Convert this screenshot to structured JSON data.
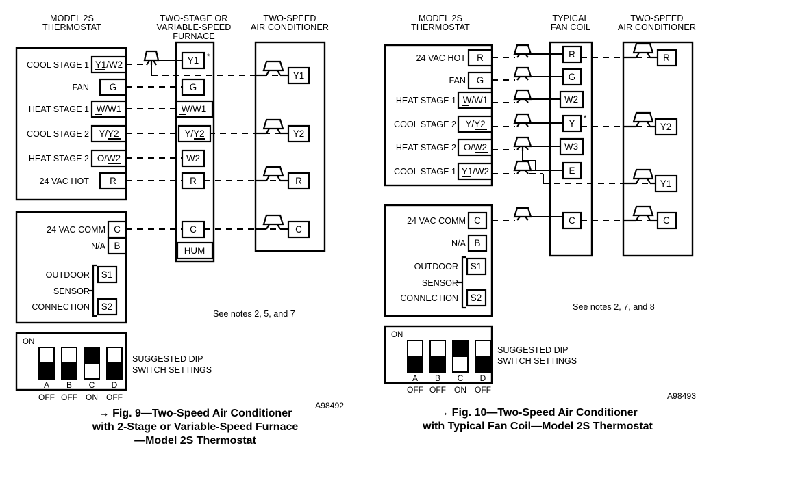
{
  "page": {
    "background": "#ffffff",
    "line_color": "#000000"
  },
  "figures": [
    {
      "id": "fig9",
      "code": "A98492",
      "notes": "See notes 2, 5, and 7",
      "caption_lines": [
        "→ Fig. 9—Two-Speed Air Conditioner",
        "with 2-Stage or Variable-Speed Furnace",
        "—Model 2S Thermostat"
      ],
      "column_headers": [
        {
          "name": "thermostat",
          "lines": [
            "MODEL 2S",
            "THERMOSTAT"
          ]
        },
        {
          "name": "furnace",
          "lines": [
            "TWO-STAGE OR",
            "VARIABLE-SPEED",
            "FURNACE"
          ]
        },
        {
          "name": "air-conditioner",
          "lines": [
            "TWO-SPEED",
            "AIR CONDITIONER"
          ]
        }
      ],
      "thermostat_upper": [
        {
          "label": "COOL STAGE 1",
          "terminal": "Y1/W2",
          "underline": "Y1"
        },
        {
          "label": "FAN",
          "terminal": "G",
          "underline": ""
        },
        {
          "label": "HEAT STAGE 1",
          "terminal": "W/W1",
          "underline": "W"
        },
        {
          "label": "COOL STAGE 2",
          "terminal": "Y/Y2",
          "underline": "Y2"
        },
        {
          "label": "HEAT STAGE 2",
          "terminal": "O/W2",
          "underline": "W2"
        },
        {
          "label": "24 VAC HOT",
          "terminal": "R",
          "underline": ""
        }
      ],
      "thermostat_lower": [
        {
          "label": "24 VAC COMM",
          "terminal": "C"
        },
        {
          "label": "N/A",
          "terminal": "B"
        },
        {
          "label": "OUTDOOR",
          "terminal": "S1"
        },
        {
          "label": "SENSOR",
          "terminal": ""
        },
        {
          "label": "CONNECTION",
          "terminal": "S2"
        }
      ],
      "middle_unit": [
        {
          "terminal": "Y1",
          "underline": "",
          "star": true
        },
        {
          "terminal": "G",
          "underline": ""
        },
        {
          "terminal": "W/W1",
          "underline": "W"
        },
        {
          "terminal": "Y/Y2",
          "underline": "Y2"
        },
        {
          "terminal": "W2",
          "underline": ""
        },
        {
          "terminal": "R",
          "underline": ""
        },
        {
          "terminal": "C",
          "underline": ""
        },
        {
          "terminal": "HUM",
          "underline": ""
        }
      ],
      "right_unit": [
        {
          "terminal": "Y1"
        },
        {
          "terminal": "Y2"
        },
        {
          "terminal": "R"
        },
        {
          "terminal": "C"
        }
      ],
      "dip": {
        "on_label": "ON",
        "title_lines": [
          "SUGGESTED DIP",
          "SWITCH SETTINGS"
        ],
        "switches": [
          {
            "name": "A",
            "state": "OFF"
          },
          {
            "name": "B",
            "state": "OFF"
          },
          {
            "name": "C",
            "state": "ON"
          },
          {
            "name": "D",
            "state": "OFF"
          }
        ]
      }
    },
    {
      "id": "fig10",
      "code": "A98493",
      "notes": "See notes 2, 7, and 8",
      "caption_lines": [
        "→ Fig. 10—Two-Speed Air Conditioner",
        "with Typical Fan Coil—Model 2S Thermostat"
      ],
      "column_headers": [
        {
          "name": "thermostat",
          "lines": [
            "MODEL 2S",
            "THERMOSTAT"
          ]
        },
        {
          "name": "fan-coil",
          "lines": [
            "TYPICAL",
            "FAN COIL"
          ]
        },
        {
          "name": "air-conditioner",
          "lines": [
            "TWO-SPEED",
            "AIR CONDITIONER"
          ]
        }
      ],
      "thermostat_upper": [
        {
          "label": "24 VAC HOT",
          "terminal": "R",
          "underline": ""
        },
        {
          "label": "FAN",
          "terminal": "G",
          "underline": ""
        },
        {
          "label": "HEAT STAGE 1",
          "terminal": "W/W1",
          "underline": "W"
        },
        {
          "label": "COOL STAGE 2",
          "terminal": "Y/Y2",
          "underline": "Y2"
        },
        {
          "label": "HEAT STAGE 2",
          "terminal": "O/W2",
          "underline": "W2"
        },
        {
          "label": "COOL STAGE 1",
          "terminal": "Y1/W2",
          "underline": "Y1"
        }
      ],
      "thermostat_lower": [
        {
          "label": "24 VAC COMM",
          "terminal": "C"
        },
        {
          "label": "N/A",
          "terminal": "B"
        },
        {
          "label": "OUTDOOR",
          "terminal": "S1"
        },
        {
          "label": "SENSOR",
          "terminal": ""
        },
        {
          "label": "CONNECTION",
          "terminal": "S2"
        }
      ],
      "middle_unit": [
        {
          "terminal": "R"
        },
        {
          "terminal": "G"
        },
        {
          "terminal": "W2"
        },
        {
          "terminal": "Y",
          "star": true
        },
        {
          "terminal": "W3"
        },
        {
          "terminal": "E"
        },
        {
          "terminal": "C"
        }
      ],
      "right_unit": [
        {
          "terminal": "R"
        },
        {
          "terminal": "Y2"
        },
        {
          "terminal": "Y1"
        },
        {
          "terminal": "C"
        }
      ],
      "dip": {
        "on_label": "ON",
        "title_lines": [
          "SUGGESTED DIP",
          "SWITCH SETTINGS"
        ],
        "switches": [
          {
            "name": "A",
            "state": "OFF"
          },
          {
            "name": "B",
            "state": "OFF"
          },
          {
            "name": "C",
            "state": "ON"
          },
          {
            "name": "D",
            "state": "OFF"
          }
        ]
      }
    }
  ]
}
